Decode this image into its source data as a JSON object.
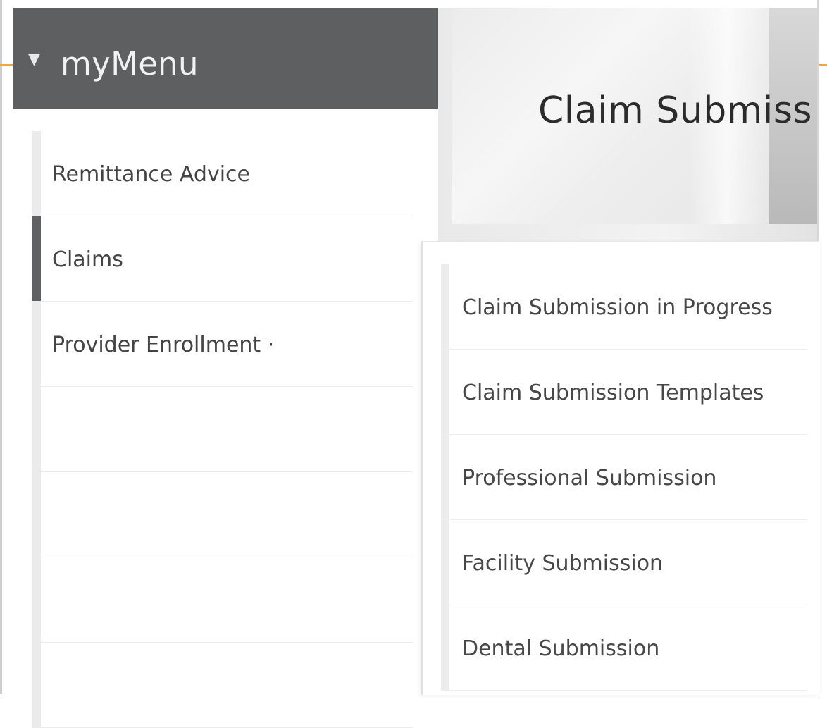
{
  "menu": {
    "title": "myMenu",
    "caret_icon": "caret-down-icon"
  },
  "banner": {
    "title": "Claim Submiss"
  },
  "nav": {
    "items": [
      {
        "label": "Remittance Advice",
        "active": false
      },
      {
        "label": "Claims",
        "active": true
      },
      {
        "label": "Provider Enrollment ·",
        "active": false
      },
      {
        "label": "",
        "active": false
      },
      {
        "label": "",
        "active": false
      },
      {
        "label": "",
        "active": false
      },
      {
        "label": "",
        "active": false
      }
    ]
  },
  "submenu": {
    "items": [
      {
        "label": "Claim Submission in Progress"
      },
      {
        "label": "Claim Submission Templates"
      },
      {
        "label": "Professional Submission"
      },
      {
        "label": "Facility Submission"
      },
      {
        "label": "Dental Submission"
      }
    ]
  },
  "colors": {
    "header_bg": "#5e5f61",
    "accent_orange": "#f0a640",
    "active_bar": "#5f6062"
  }
}
